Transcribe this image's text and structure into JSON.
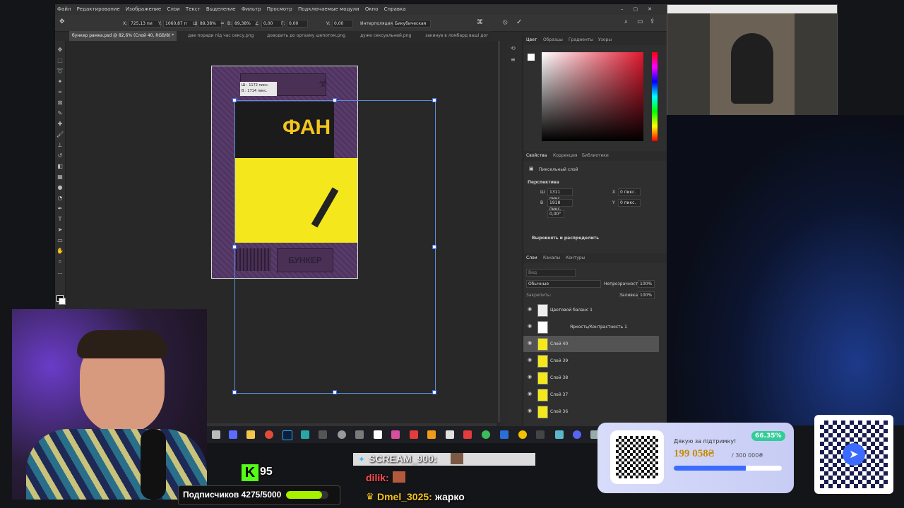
{
  "ps": {
    "menu": [
      "Файл",
      "Редактирование",
      "Изображение",
      "Слои",
      "Текст",
      "Выделение",
      "Фильтр",
      "Просмотр",
      "Подключаемые модули",
      "Окно",
      "Справка"
    ],
    "options": {
      "x_label": "X:",
      "x_value": "725,13 пи",
      "y_label": "Y:",
      "y_value": "1060,87 п",
      "w_label": "Ш:",
      "w_value": "89,38%",
      "h_label": "В:",
      "h_value": "89,38%",
      "angle_label": "∠",
      "angle_value": "0,00",
      "hskew_label": "Г:",
      "hskew_value": "0,00",
      "vskew_label": "V:",
      "vskew_value": "0,00",
      "interp_label": "Интерполяция:",
      "interp_value": "Бикубическая"
    },
    "tabs": [
      "бункер рамка.psd @ 82,6% (Слой 40, RGB/8) *",
      "дае поради пiд час сексу.png",
      "доводить до оргазму шепотом.png",
      "дуже сексуальний.png",
      "закинув в ломбард вашi дог"
    ],
    "transform_tooltip": [
      "Ш : 1172 пикс.",
      "В : 1714 пикс."
    ],
    "artwork": {
      "top_text": "ФАН",
      "bottom_plate": "БУНКЕР"
    },
    "panels": {
      "color_tabs": [
        "Цвет",
        "Образцы",
        "Градиенты",
        "Узоры"
      ],
      "props_tabs": [
        "Свойства",
        "Коррекция",
        "Библиотеки"
      ],
      "pixel_layer": "Пиксельный слой",
      "perspective": "Перспектива",
      "w_label": "Ш",
      "w_value": "1311 пикс.",
      "h_label": "В",
      "h_value": "1918 пикс.",
      "x_label": "X",
      "x_value": "0 пикс.",
      "y_label": "Y",
      "y_value": "0 пикс.",
      "angle_value": "0,00°",
      "align": "Выровнять и распределить",
      "layers_tabs": [
        "Слои",
        "Каналы",
        "Контуры"
      ],
      "search_placeholder": "Вид",
      "blend_mode": "Обычные",
      "opacity_label": "Непрозрачность:",
      "opacity_value": "100%",
      "lock_label": "Закрепить:",
      "fill_label": "Заливка:",
      "fill_value": "100%",
      "layers": [
        "Цветовой баланс 1",
        "Яркость/Контрастность 1",
        "Слой 40",
        "Слой 39",
        "Слой 38",
        "Слой 37",
        "Слой 36"
      ]
    }
  },
  "overlay": {
    "kick_count": "95",
    "subs": "Подписчиков 4275/5000",
    "subs_progress": 0.855,
    "chat": [
      {
        "user": "SCREAM_900:",
        "text": ""
      },
      {
        "user": "dilik:",
        "text": ""
      },
      {
        "user": "Dmel_3025:",
        "text": "жарко"
      }
    ],
    "donate": {
      "thanks": "Дякую за підтримку!",
      "percent": "66.35%",
      "amount": "199 058₴",
      "goal": "/ 300 000₴",
      "progress": 0.6635
    }
  },
  "colors": {
    "ps_bg": "#2b2b2b",
    "accent_blue": "#3b6cff",
    "yellow": "#f4e81c",
    "purple": "#5b3d6c",
    "kick_green": "#53fc18"
  }
}
